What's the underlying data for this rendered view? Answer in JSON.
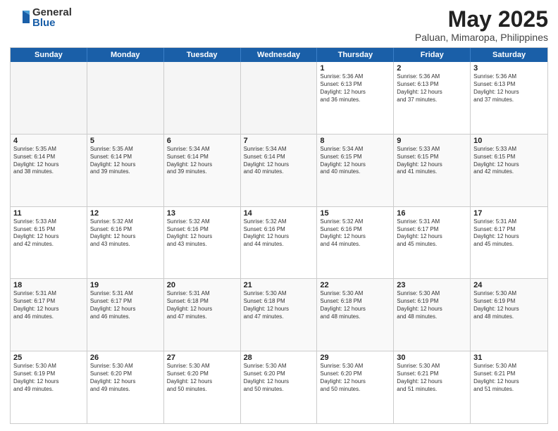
{
  "logo": {
    "general": "General",
    "blue": "Blue"
  },
  "title": {
    "month": "May 2025",
    "location": "Paluan, Mimaropa, Philippines"
  },
  "weekdays": [
    "Sunday",
    "Monday",
    "Tuesday",
    "Wednesday",
    "Thursday",
    "Friday",
    "Saturday"
  ],
  "weeks": [
    [
      {
        "day": "",
        "text": "",
        "empty": true
      },
      {
        "day": "",
        "text": "",
        "empty": true
      },
      {
        "day": "",
        "text": "",
        "empty": true
      },
      {
        "day": "",
        "text": "",
        "empty": true
      },
      {
        "day": "1",
        "text": "Sunrise: 5:36 AM\nSunset: 6:13 PM\nDaylight: 12 hours\nand 36 minutes.",
        "empty": false
      },
      {
        "day": "2",
        "text": "Sunrise: 5:36 AM\nSunset: 6:13 PM\nDaylight: 12 hours\nand 37 minutes.",
        "empty": false
      },
      {
        "day": "3",
        "text": "Sunrise: 5:36 AM\nSunset: 6:13 PM\nDaylight: 12 hours\nand 37 minutes.",
        "empty": false
      }
    ],
    [
      {
        "day": "4",
        "text": "Sunrise: 5:35 AM\nSunset: 6:14 PM\nDaylight: 12 hours\nand 38 minutes.",
        "empty": false
      },
      {
        "day": "5",
        "text": "Sunrise: 5:35 AM\nSunset: 6:14 PM\nDaylight: 12 hours\nand 39 minutes.",
        "empty": false
      },
      {
        "day": "6",
        "text": "Sunrise: 5:34 AM\nSunset: 6:14 PM\nDaylight: 12 hours\nand 39 minutes.",
        "empty": false
      },
      {
        "day": "7",
        "text": "Sunrise: 5:34 AM\nSunset: 6:14 PM\nDaylight: 12 hours\nand 40 minutes.",
        "empty": false
      },
      {
        "day": "8",
        "text": "Sunrise: 5:34 AM\nSunset: 6:15 PM\nDaylight: 12 hours\nand 40 minutes.",
        "empty": false
      },
      {
        "day": "9",
        "text": "Sunrise: 5:33 AM\nSunset: 6:15 PM\nDaylight: 12 hours\nand 41 minutes.",
        "empty": false
      },
      {
        "day": "10",
        "text": "Sunrise: 5:33 AM\nSunset: 6:15 PM\nDaylight: 12 hours\nand 42 minutes.",
        "empty": false
      }
    ],
    [
      {
        "day": "11",
        "text": "Sunrise: 5:33 AM\nSunset: 6:15 PM\nDaylight: 12 hours\nand 42 minutes.",
        "empty": false
      },
      {
        "day": "12",
        "text": "Sunrise: 5:32 AM\nSunset: 6:16 PM\nDaylight: 12 hours\nand 43 minutes.",
        "empty": false
      },
      {
        "day": "13",
        "text": "Sunrise: 5:32 AM\nSunset: 6:16 PM\nDaylight: 12 hours\nand 43 minutes.",
        "empty": false
      },
      {
        "day": "14",
        "text": "Sunrise: 5:32 AM\nSunset: 6:16 PM\nDaylight: 12 hours\nand 44 minutes.",
        "empty": false
      },
      {
        "day": "15",
        "text": "Sunrise: 5:32 AM\nSunset: 6:16 PM\nDaylight: 12 hours\nand 44 minutes.",
        "empty": false
      },
      {
        "day": "16",
        "text": "Sunrise: 5:31 AM\nSunset: 6:17 PM\nDaylight: 12 hours\nand 45 minutes.",
        "empty": false
      },
      {
        "day": "17",
        "text": "Sunrise: 5:31 AM\nSunset: 6:17 PM\nDaylight: 12 hours\nand 45 minutes.",
        "empty": false
      }
    ],
    [
      {
        "day": "18",
        "text": "Sunrise: 5:31 AM\nSunset: 6:17 PM\nDaylight: 12 hours\nand 46 minutes.",
        "empty": false
      },
      {
        "day": "19",
        "text": "Sunrise: 5:31 AM\nSunset: 6:17 PM\nDaylight: 12 hours\nand 46 minutes.",
        "empty": false
      },
      {
        "day": "20",
        "text": "Sunrise: 5:31 AM\nSunset: 6:18 PM\nDaylight: 12 hours\nand 47 minutes.",
        "empty": false
      },
      {
        "day": "21",
        "text": "Sunrise: 5:30 AM\nSunset: 6:18 PM\nDaylight: 12 hours\nand 47 minutes.",
        "empty": false
      },
      {
        "day": "22",
        "text": "Sunrise: 5:30 AM\nSunset: 6:18 PM\nDaylight: 12 hours\nand 48 minutes.",
        "empty": false
      },
      {
        "day": "23",
        "text": "Sunrise: 5:30 AM\nSunset: 6:19 PM\nDaylight: 12 hours\nand 48 minutes.",
        "empty": false
      },
      {
        "day": "24",
        "text": "Sunrise: 5:30 AM\nSunset: 6:19 PM\nDaylight: 12 hours\nand 48 minutes.",
        "empty": false
      }
    ],
    [
      {
        "day": "25",
        "text": "Sunrise: 5:30 AM\nSunset: 6:19 PM\nDaylight: 12 hours\nand 49 minutes.",
        "empty": false
      },
      {
        "day": "26",
        "text": "Sunrise: 5:30 AM\nSunset: 6:20 PM\nDaylight: 12 hours\nand 49 minutes.",
        "empty": false
      },
      {
        "day": "27",
        "text": "Sunrise: 5:30 AM\nSunset: 6:20 PM\nDaylight: 12 hours\nand 50 minutes.",
        "empty": false
      },
      {
        "day": "28",
        "text": "Sunrise: 5:30 AM\nSunset: 6:20 PM\nDaylight: 12 hours\nand 50 minutes.",
        "empty": false
      },
      {
        "day": "29",
        "text": "Sunrise: 5:30 AM\nSunset: 6:20 PM\nDaylight: 12 hours\nand 50 minutes.",
        "empty": false
      },
      {
        "day": "30",
        "text": "Sunrise: 5:30 AM\nSunset: 6:21 PM\nDaylight: 12 hours\nand 51 minutes.",
        "empty": false
      },
      {
        "day": "31",
        "text": "Sunrise: 5:30 AM\nSunset: 6:21 PM\nDaylight: 12 hours\nand 51 minutes.",
        "empty": false
      }
    ]
  ]
}
